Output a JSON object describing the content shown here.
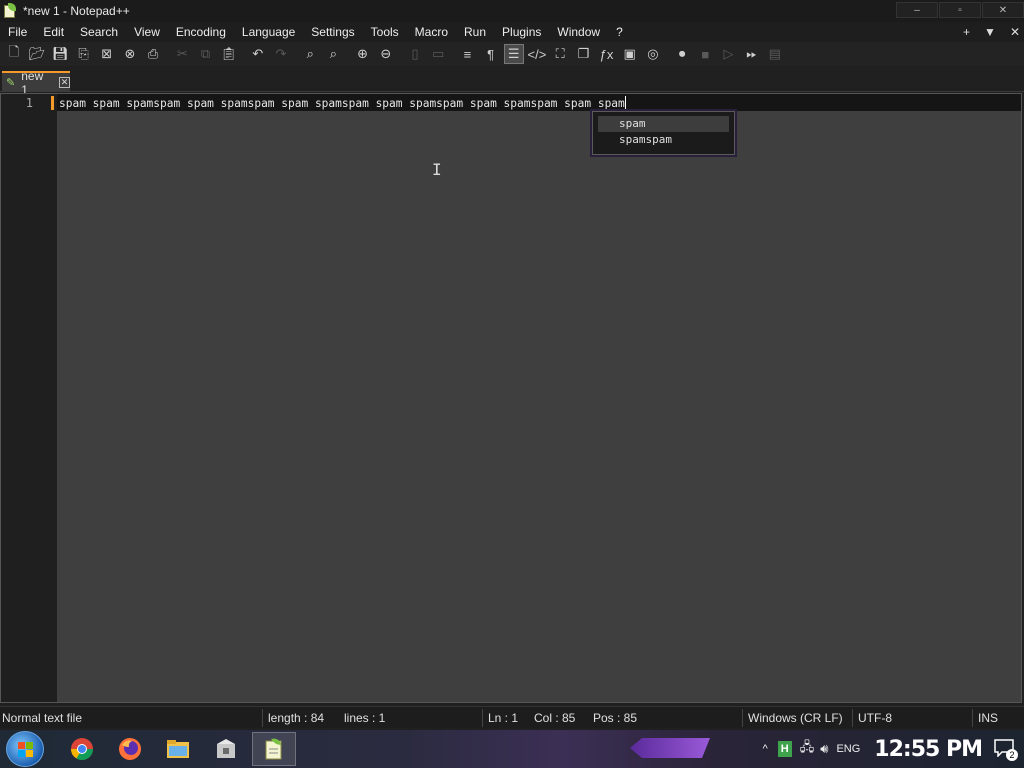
{
  "window": {
    "title": "*new 1 - Notepad++",
    "controls": {
      "minimize": "–",
      "maximize": "▫",
      "close": "✕"
    }
  },
  "menu": {
    "items": [
      "File",
      "Edit",
      "Search",
      "View",
      "Encoding",
      "Language",
      "Settings",
      "Tools",
      "Macro",
      "Run",
      "Plugins",
      "Window",
      "?"
    ],
    "right": {
      "add": "+",
      "dropdown": "▼",
      "close": "✕"
    }
  },
  "toolbar": {
    "icons": [
      "new-file-icon",
      "open-file-icon",
      "save-icon",
      "save-all-icon",
      "close-icon",
      "close-all-icon",
      "print-icon",
      "cut-icon",
      "copy-icon",
      "paste-icon",
      "undo-icon",
      "redo-icon",
      "find-icon",
      "replace-icon",
      "zoom-in-icon",
      "zoom-out-icon",
      "sync-vertical-icon",
      "sync-horizontal-icon",
      "word-wrap-icon",
      "show-all-chars-icon",
      "indent-guide-icon",
      "xml-tag-icon",
      "document-map-icon",
      "document-list-icon",
      "function-list-icon",
      "folder-workspace-icon",
      "monitoring-icon",
      "record-macro-icon",
      "stop-macro-icon",
      "play-macro-icon",
      "run-macro-multiple-icon",
      "save-macro-icon"
    ]
  },
  "tabs": [
    {
      "label": "new 1",
      "close": "✕"
    }
  ],
  "editor": {
    "line_number": "1",
    "line_text": "spam spam spamspam spam spamspam spam spamspam spam spamspam spam spamspam spam spam",
    "autocomplete": [
      "spam",
      "spamspam"
    ]
  },
  "status": {
    "file_type": "Normal text file",
    "length": "length : 84",
    "lines": "lines : 1",
    "ln": "Ln : 1",
    "col": "Col : 85",
    "pos": "Pos : 85",
    "eol": "Windows (CR LF)",
    "encoding": "UTF-8",
    "mode": "INS"
  },
  "taskbar": {
    "apps": [
      "chrome-icon",
      "firefox-icon",
      "file-explorer-icon",
      "app-installer-icon",
      "notepad-plus-plus-icon"
    ],
    "tray": {
      "show_hidden": "^",
      "lang": "ENG",
      "clock": "12:55 PM",
      "notifications": "2"
    }
  },
  "colors": {
    "accent_orange": "#f39a2a",
    "editor_bg": "#3f3f3f",
    "gutter_bg": "#1f1f1f",
    "current_line_bg": "#151515"
  }
}
